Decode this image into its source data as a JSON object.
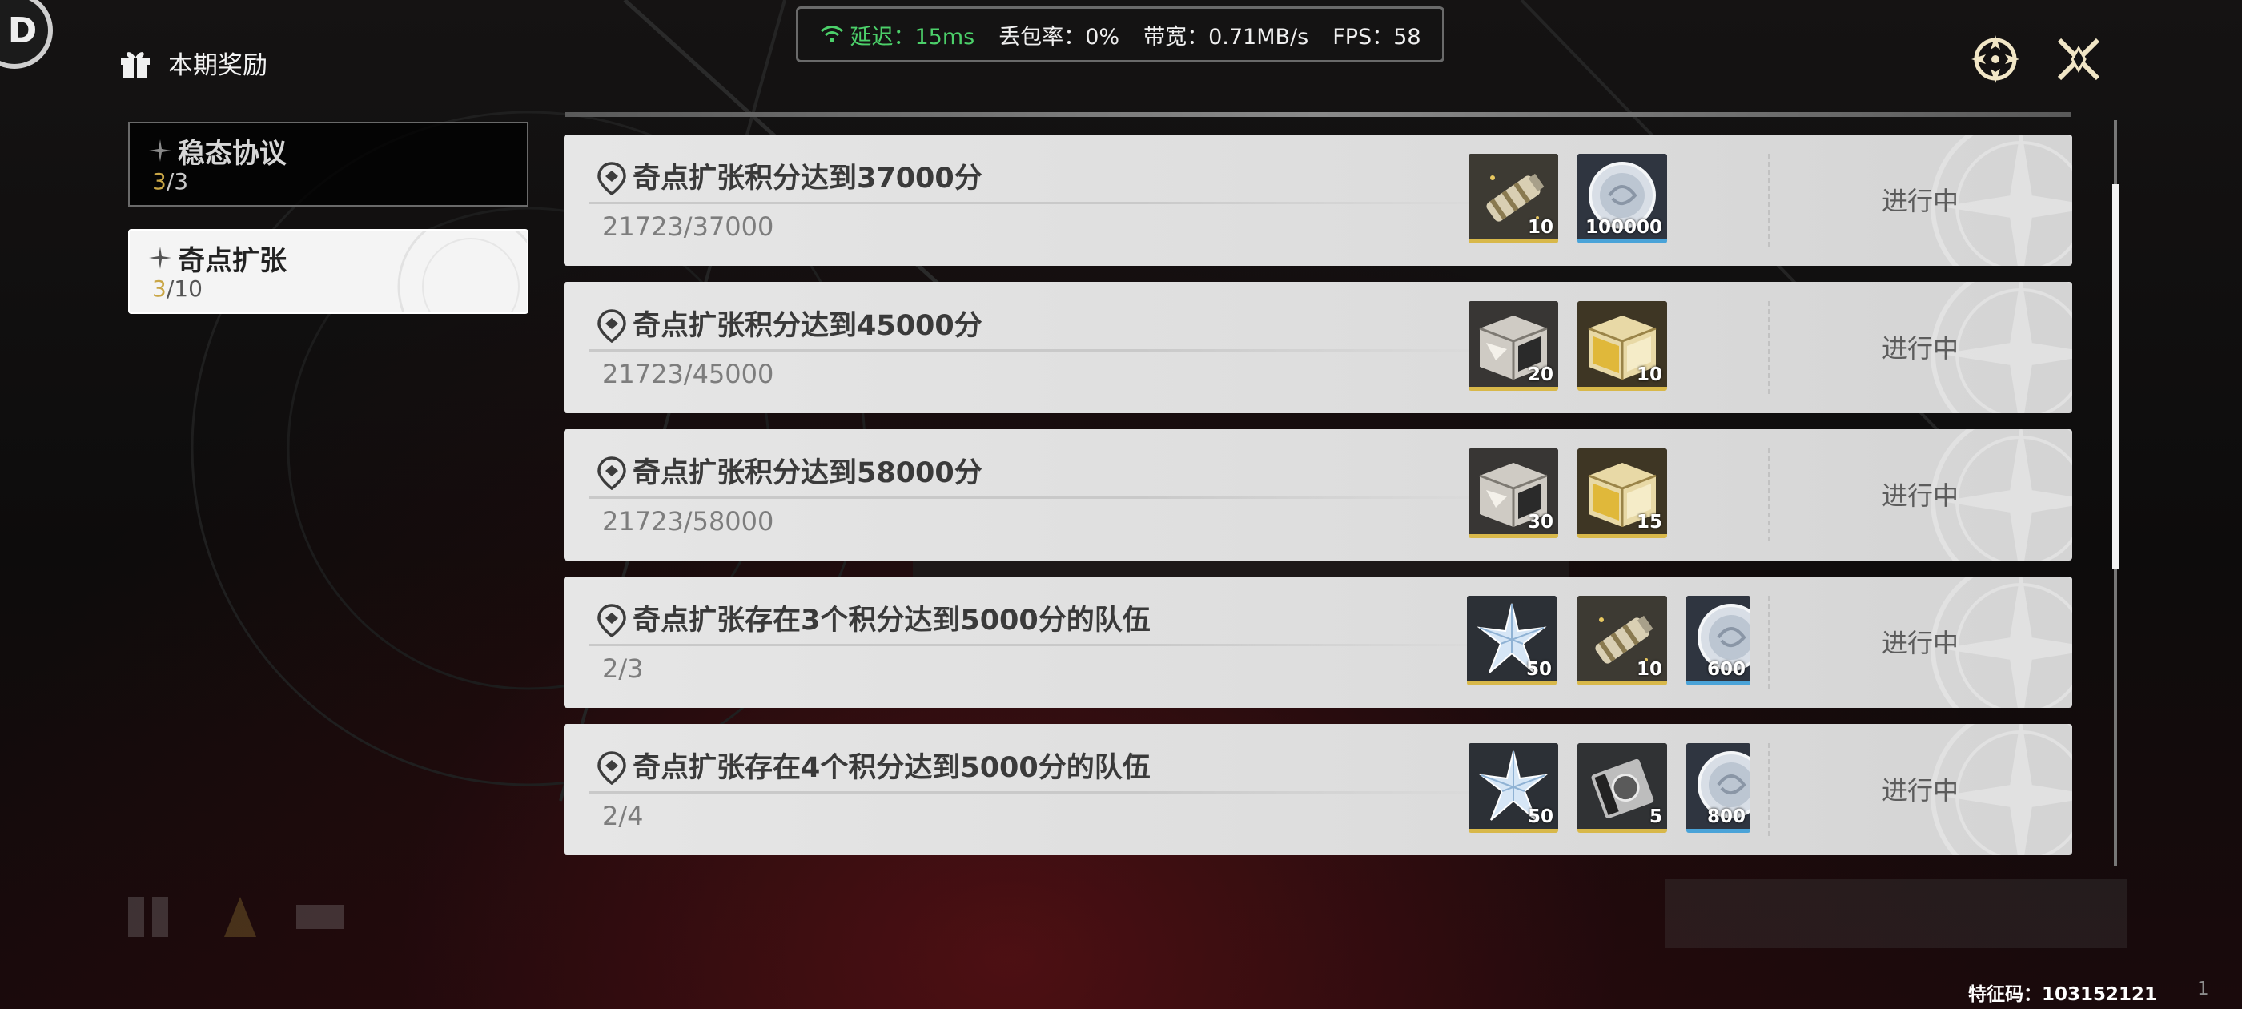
{
  "header": {
    "logo_glyph": "D",
    "title": "本期奖励",
    "gift_icon": "gift-icon"
  },
  "netstats": {
    "latency": "延迟：15ms",
    "packet_loss": "丢包率：0%",
    "bandwidth": "带宽：0.71MB/s",
    "fps": "FPS：58",
    "latency_color": "#4cd06a"
  },
  "top_right": {
    "target_icon": "crosshair-icon",
    "close_icon": "close-icon"
  },
  "tabs": [
    {
      "name": "稳态协议",
      "current": "3",
      "total": "/3"
    },
    {
      "name": "奇点扩张",
      "current": "3",
      "total": "/10"
    }
  ],
  "tasks": [
    {
      "title": "奇点扩张积分达到37000分",
      "progress": "21723/37000",
      "status": "进行中",
      "rewards": [
        {
          "icon": "canister-icon",
          "qty": "10"
        },
        {
          "icon": "coin-icon",
          "qty": "100000"
        }
      ]
    },
    {
      "title": "奇点扩张积分达到45000分",
      "progress": "21723/45000",
      "status": "进行中",
      "rewards": [
        {
          "icon": "silver-crate-icon",
          "qty": "20"
        },
        {
          "icon": "gold-crate-icon",
          "qty": "10"
        }
      ]
    },
    {
      "title": "奇点扩张积分达到58000分",
      "progress": "21723/58000",
      "status": "进行中",
      "rewards": [
        {
          "icon": "silver-crate-icon",
          "qty": "30"
        },
        {
          "icon": "gold-crate-icon",
          "qty": "15"
        }
      ]
    },
    {
      "title": "奇点扩张存在3个积分达到5000分的队伍",
      "progress": "2/3",
      "status": "进行中",
      "rewards": [
        {
          "icon": "crystal-star-icon",
          "qty": "50"
        },
        {
          "icon": "canister-icon",
          "qty": "10"
        },
        {
          "icon": "coin-icon",
          "qty": "600"
        }
      ]
    },
    {
      "title": "奇点扩张存在4个积分达到5000分的队伍",
      "progress": "2/4",
      "status": "进行中",
      "rewards": [
        {
          "icon": "crystal-star-icon",
          "qty": "50"
        },
        {
          "icon": "device-icon",
          "qty": "5"
        },
        {
          "icon": "coin-icon",
          "qty": "800"
        }
      ]
    }
  ],
  "footer": {
    "code": "特征码：103152121",
    "page": "1"
  },
  "colors": {
    "accent_gold": "#c9a646",
    "reward_gold_bar": "#d8b84a",
    "reward_blue_bar": "#4aa3d8"
  }
}
